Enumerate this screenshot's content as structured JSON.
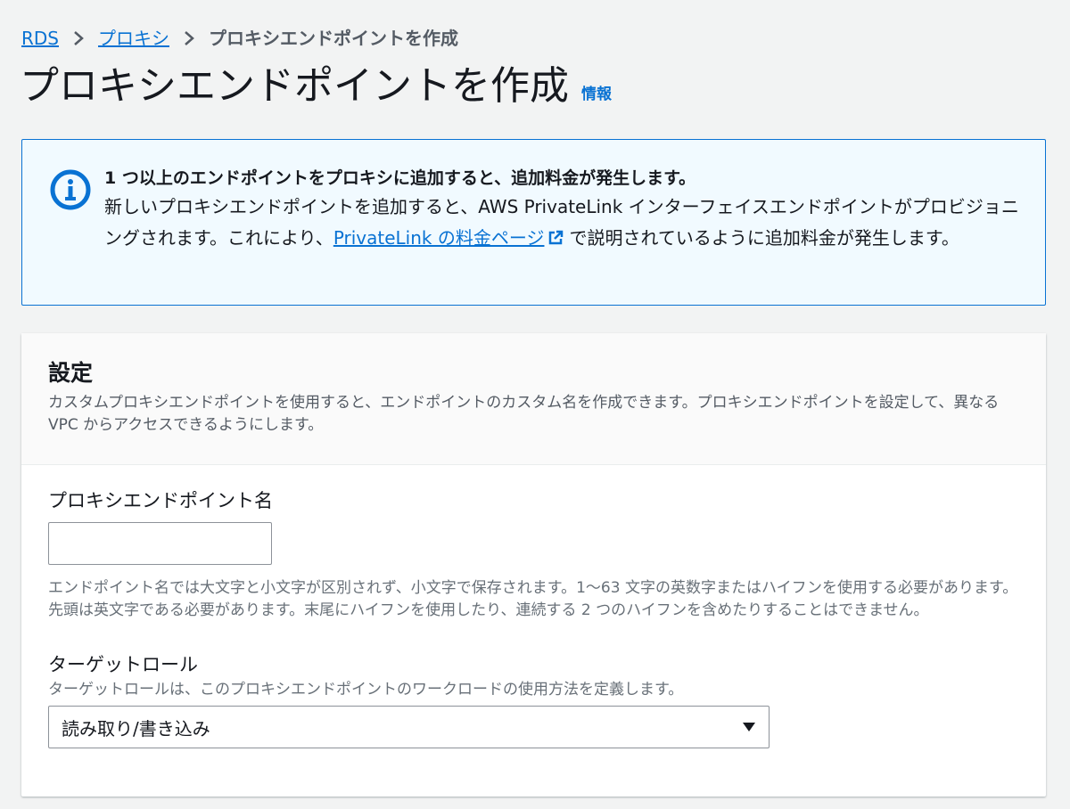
{
  "breadcrumb": {
    "items": [
      "RDS",
      "プロキシ"
    ],
    "current": "プロキシエンドポイントを作成"
  },
  "page": {
    "title": "プロキシエンドポイントを作成",
    "info_link": "情報"
  },
  "alert": {
    "title": "1 つ以上のエンドポイントをプロキシに追加すると、追加料金が発生します。",
    "text_before": "新しいプロキシエンドポイントを追加すると、AWS PrivateLink インターフェイスエンドポイントがプロビジョニングされます。これにより、",
    "link": "PrivateLink の料金ページ",
    "text_after": "で説明されているように追加料金が発生します。"
  },
  "settings": {
    "title": "設定",
    "description": "カスタムプロキシエンドポイントを使用すると、エンドポイントのカスタム名を作成できます。プロキシエンドポイントを設定して、異なる VPC からアクセスできるようにします。",
    "endpoint_name": {
      "label": "プロキシエンドポイント名",
      "value": "",
      "hint": "エンドポイント名では大文字と小文字が区別されず、小文字で保存されます。1〜63 文字の英数字またはハイフンを使用する必要があります。先頭は英文字である必要があります。末尾にハイフンを使用したり、連続する 2 つのハイフンを含めたりすることはできません。"
    },
    "target_role": {
      "label": "ターゲットロール",
      "hint": "ターゲットロールは、このプロキシエンドポイントのワークロードの使用方法を定義します。",
      "selected": "読み取り/書き込み"
    }
  },
  "colors": {
    "link": "#0972d3",
    "alert_bg": "#f1faff",
    "alert_border": "#0972d3"
  }
}
